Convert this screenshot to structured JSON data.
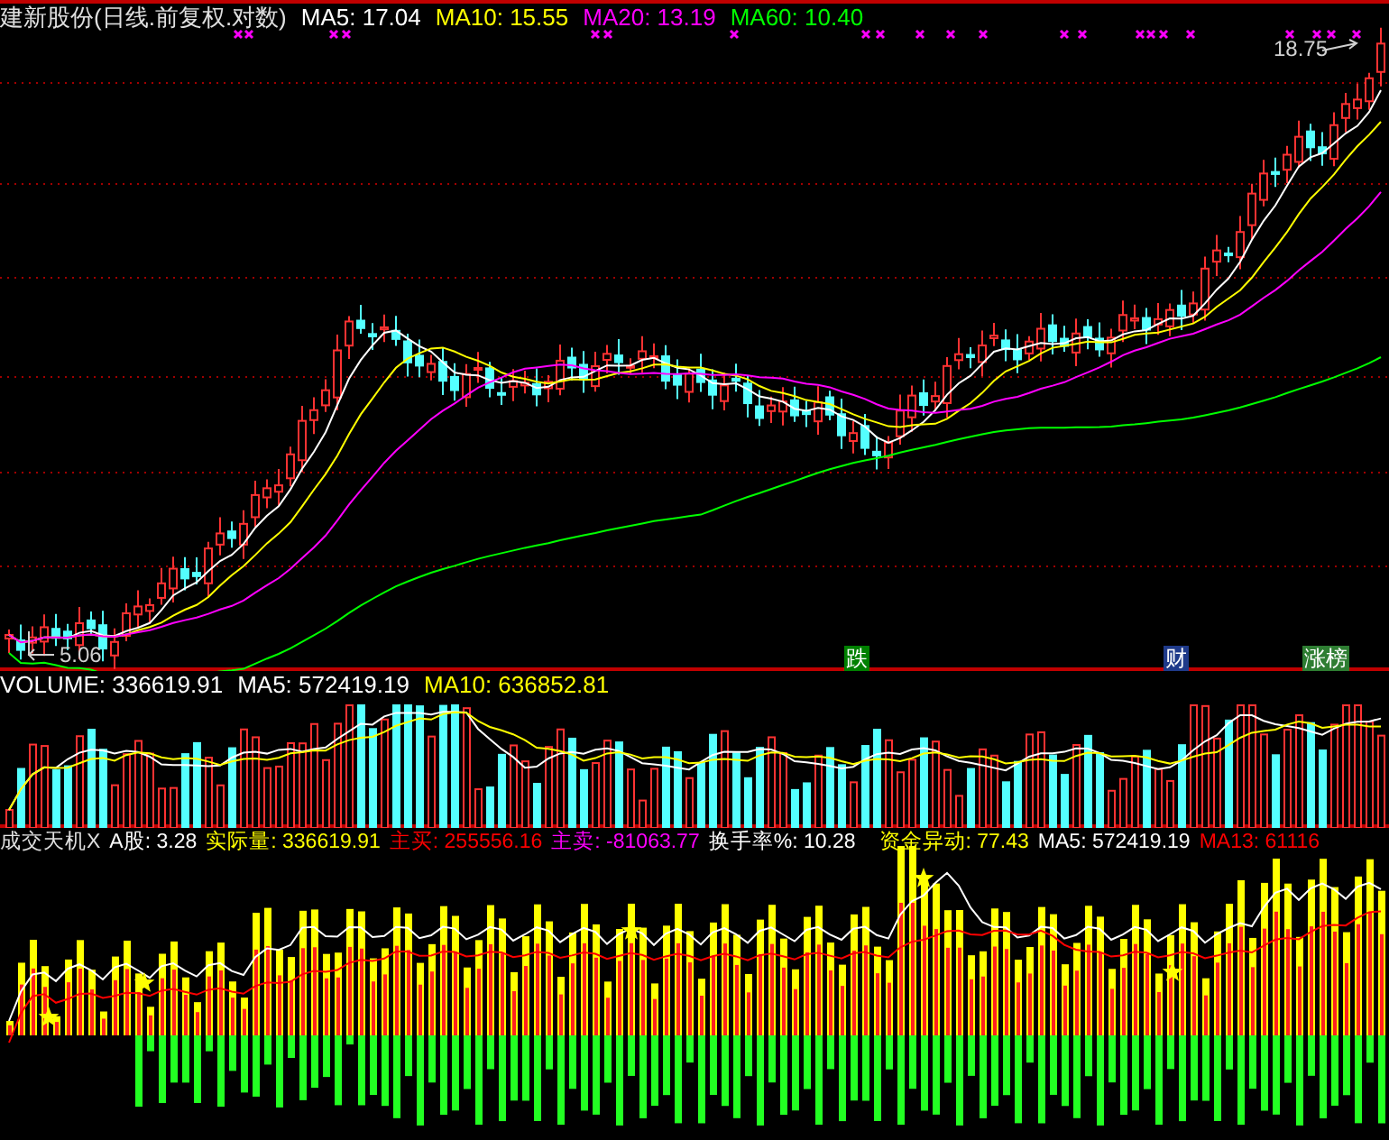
{
  "price_pane": {
    "title": "建新股份(日线.前复权.对数)",
    "indicators": [
      {
        "label": "MA5: 17.04",
        "color": "#ffffff"
      },
      {
        "label": "MA10: 15.55",
        "color": "#ffff00"
      },
      {
        "label": "MA20: 13.19",
        "color": "#ff00ff"
      },
      {
        "label": "MA60: 10.40",
        "color": "#00ff00"
      }
    ],
    "high_label": "18.75",
    "low_label": "5.06",
    "events": [
      {
        "label": "跌",
        "color": "#008000"
      },
      {
        "label": "财",
        "color": "#1f3a8a"
      },
      {
        "label": "涨榜",
        "color": "#2e7d32"
      }
    ]
  },
  "volume_pane": {
    "indicators": [
      {
        "label": "VOLUME: 336619.91",
        "color": "#ffffff"
      },
      {
        "label": "MA5: 572419.19",
        "color": "#ffffff"
      },
      {
        "label": "MA10: 636852.81",
        "color": "#ffff00"
      }
    ]
  },
  "indicator_pane": {
    "title": "成交天机X",
    "indicators": [
      {
        "label": "A股: 3.28",
        "color": "#ffffff"
      },
      {
        "label": "实际量: 336619.91",
        "color": "#ffff00"
      },
      {
        "label": "主买: 255556.16",
        "color": "#ff0000"
      },
      {
        "label": "主卖: -81063.77",
        "color": "#ff00ff"
      },
      {
        "label": "换手率%: 10.28",
        "color": "#ffffff"
      },
      {
        "label": "资金异动: 77.43",
        "color": "#ffff00"
      },
      {
        "label": "MA5: 572419.19",
        "color": "#ffffff"
      },
      {
        "label": "MA13: 61116",
        "color": "#ff0000"
      }
    ]
  }
}
